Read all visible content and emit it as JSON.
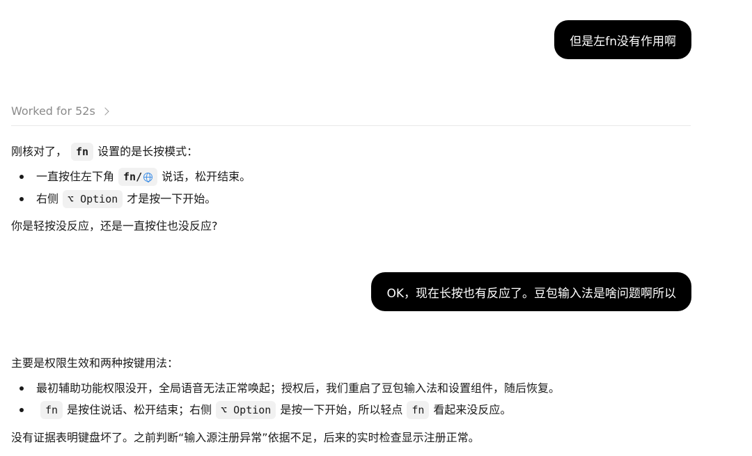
{
  "messages": {
    "user1": "但是左fn没有作用啊",
    "user2": "OK，现在长按也有反应了。豆包输入法是啥问题啊所以"
  },
  "worked": {
    "label": "Worked for 52s"
  },
  "reply1": {
    "intro_pre": "刚核对了，",
    "intro_code": "fn",
    "intro_post": "设置的是长按模式：",
    "bullet1_pre": "一直按住左下角",
    "bullet1_code": "fn/",
    "bullet1_icon": "globe-icon",
    "bullet1_post": "说话，松开结束。",
    "bullet2_pre": "右侧",
    "bullet2_code": "⌥ Option",
    "bullet2_post": "才是按一下开始。",
    "question": "你是轻按没反应，还是一直按住也没反应?"
  },
  "reply2": {
    "intro": "主要是权限生效和两种按键用法：",
    "bullet1": "最初辅助功能权限没开，全局语音无法正常唤起；授权后，我们重启了豆包输入法和设置组件，随后恢复。",
    "bullet2_code1": "fn",
    "bullet2_mid1": "是按住说话、松开结束；右侧",
    "bullet2_code2": "⌥ Option",
    "bullet2_mid2": "是按一下开始，所以轻点",
    "bullet2_code3": "fn",
    "bullet2_post": "看起来没反应。",
    "conclusion": "没有证据表明键盘坏了。之前判断“输入源注册异常”依据不足，后来的实时检查显示注册正常。"
  }
}
